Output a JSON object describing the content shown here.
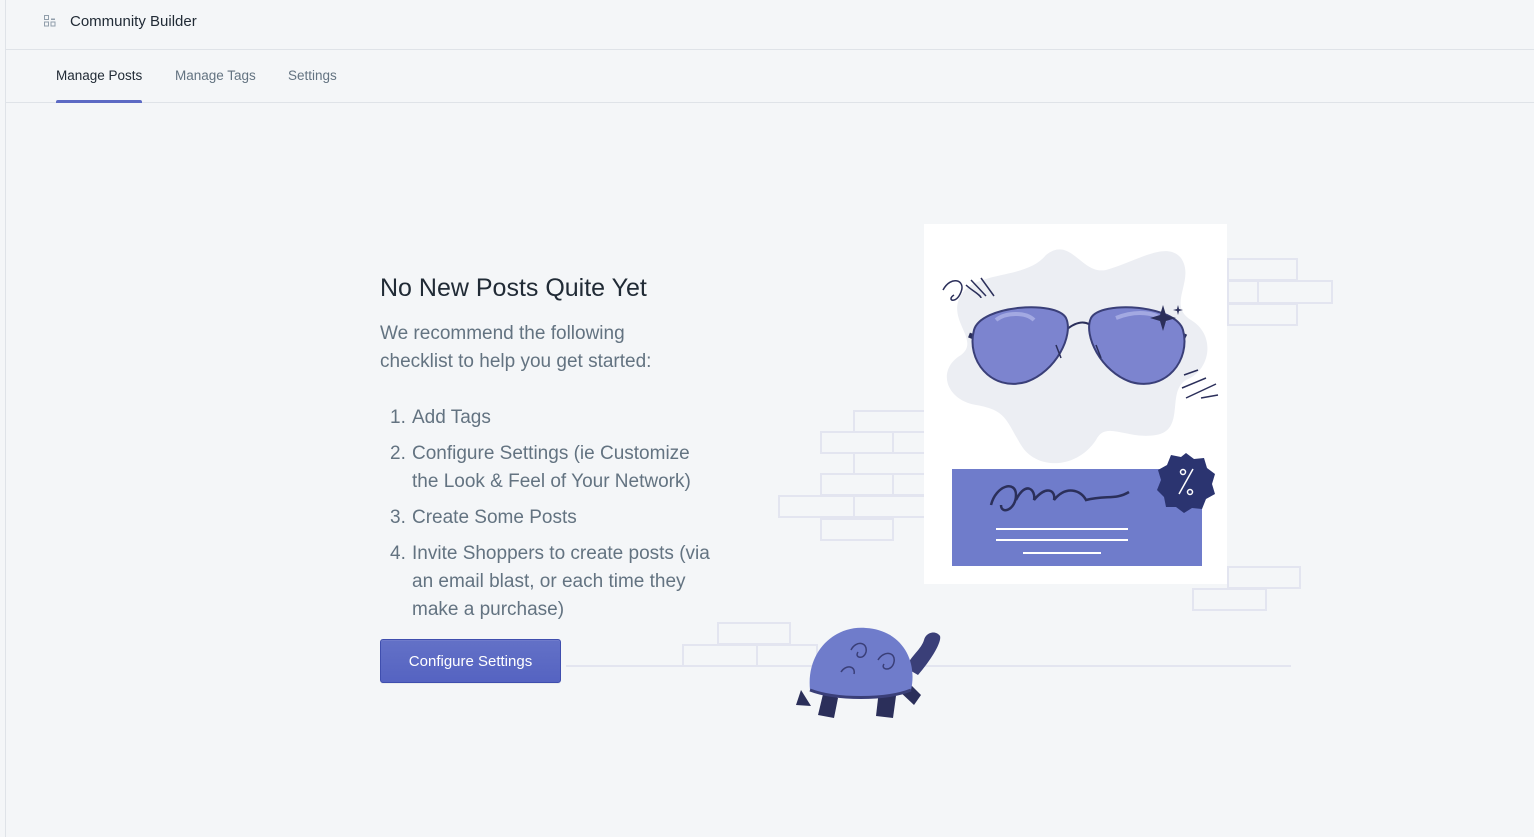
{
  "app": {
    "title": "Community Builder",
    "icon": "apps-grid-icon"
  },
  "tabs": [
    {
      "label": "Manage Posts",
      "active": true
    },
    {
      "label": "Manage Tags",
      "active": false
    },
    {
      "label": "Settings",
      "active": false
    }
  ],
  "empty_state": {
    "heading": "No New Posts Quite Yet",
    "intro": "We recommend the following checklist to help you get started:",
    "checklist": [
      {
        "num": "1.",
        "text": "Add Tags"
      },
      {
        "num": "2.",
        "text": "Configure Settings (ie Customize the Look & Feel of Your Network)"
      },
      {
        "num": "3.",
        "text": "Create Some Posts"
      },
      {
        "num": "4.",
        "text": "Invite Shoppers to create posts (via an email blast, or each time they make a purchase)"
      }
    ],
    "button_label": "Configure Settings",
    "illustration": "turtle-sunglasses-coupon-illustration"
  },
  "colors": {
    "accent": "#5c6ac4",
    "background": "#f4f6f8",
    "text": "#212b36",
    "subdued_text": "#637381",
    "border": "#dfe3e8"
  }
}
